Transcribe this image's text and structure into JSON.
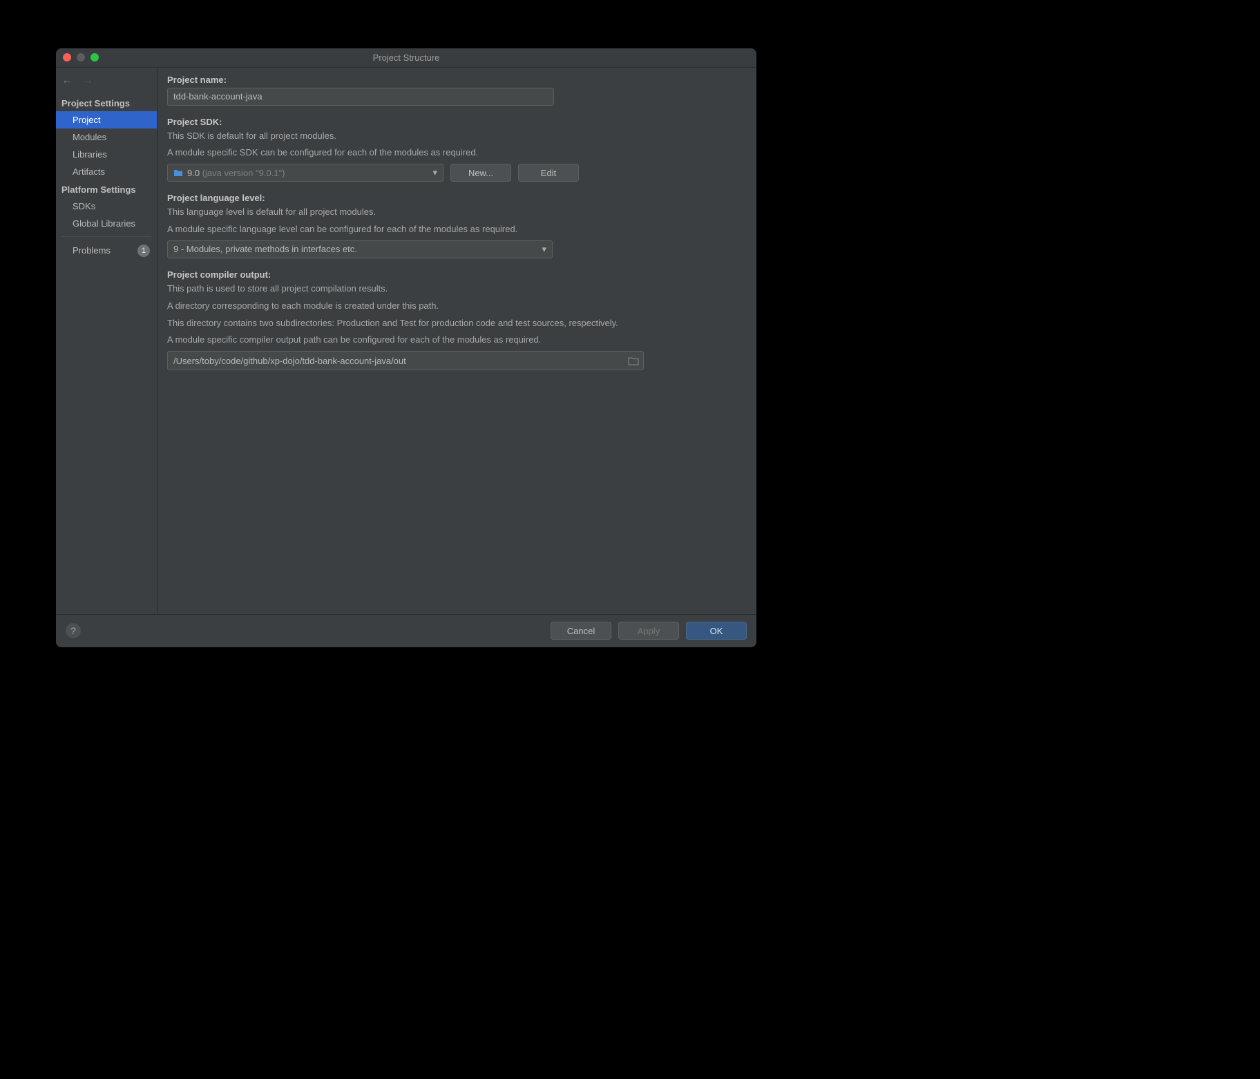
{
  "window": {
    "title": "Project Structure"
  },
  "sidebar": {
    "section_project": "Project Settings",
    "items_project": [
      "Project",
      "Modules",
      "Libraries",
      "Artifacts"
    ],
    "section_platform": "Platform Settings",
    "items_platform": [
      "SDKs",
      "Global Libraries"
    ],
    "problems_label": "Problems",
    "problems_count": "1"
  },
  "content": {
    "project_name_label": "Project name:",
    "project_name_value": "tdd-bank-account-java",
    "sdk_label": "Project SDK:",
    "sdk_desc1": "This SDK is default for all project modules.",
    "sdk_desc2": "A module specific SDK can be configured for each of the modules as required.",
    "sdk_value": "9.0",
    "sdk_version": "(java version \"9.0.1\")",
    "btn_new": "New...",
    "btn_edit": "Edit",
    "lang_label": "Project language level:",
    "lang_desc1": "This language level is default for all project modules.",
    "lang_desc2": "A module specific language level can be configured for each of the modules as required.",
    "lang_value": "9 - Modules, private methods in interfaces etc.",
    "out_label": "Project compiler output:",
    "out_desc1": "This path is used to store all project compilation results.",
    "out_desc2": "A directory corresponding to each module is created under this path.",
    "out_desc3": "This directory contains two subdirectories: Production and Test for production code and test sources, respectively.",
    "out_desc4": "A module specific compiler output path can be configured for each of the modules as required.",
    "out_value": "/Users/toby/code/github/xp-dojo/tdd-bank-account-java/out"
  },
  "footer": {
    "cancel": "Cancel",
    "apply": "Apply",
    "ok": "OK"
  }
}
